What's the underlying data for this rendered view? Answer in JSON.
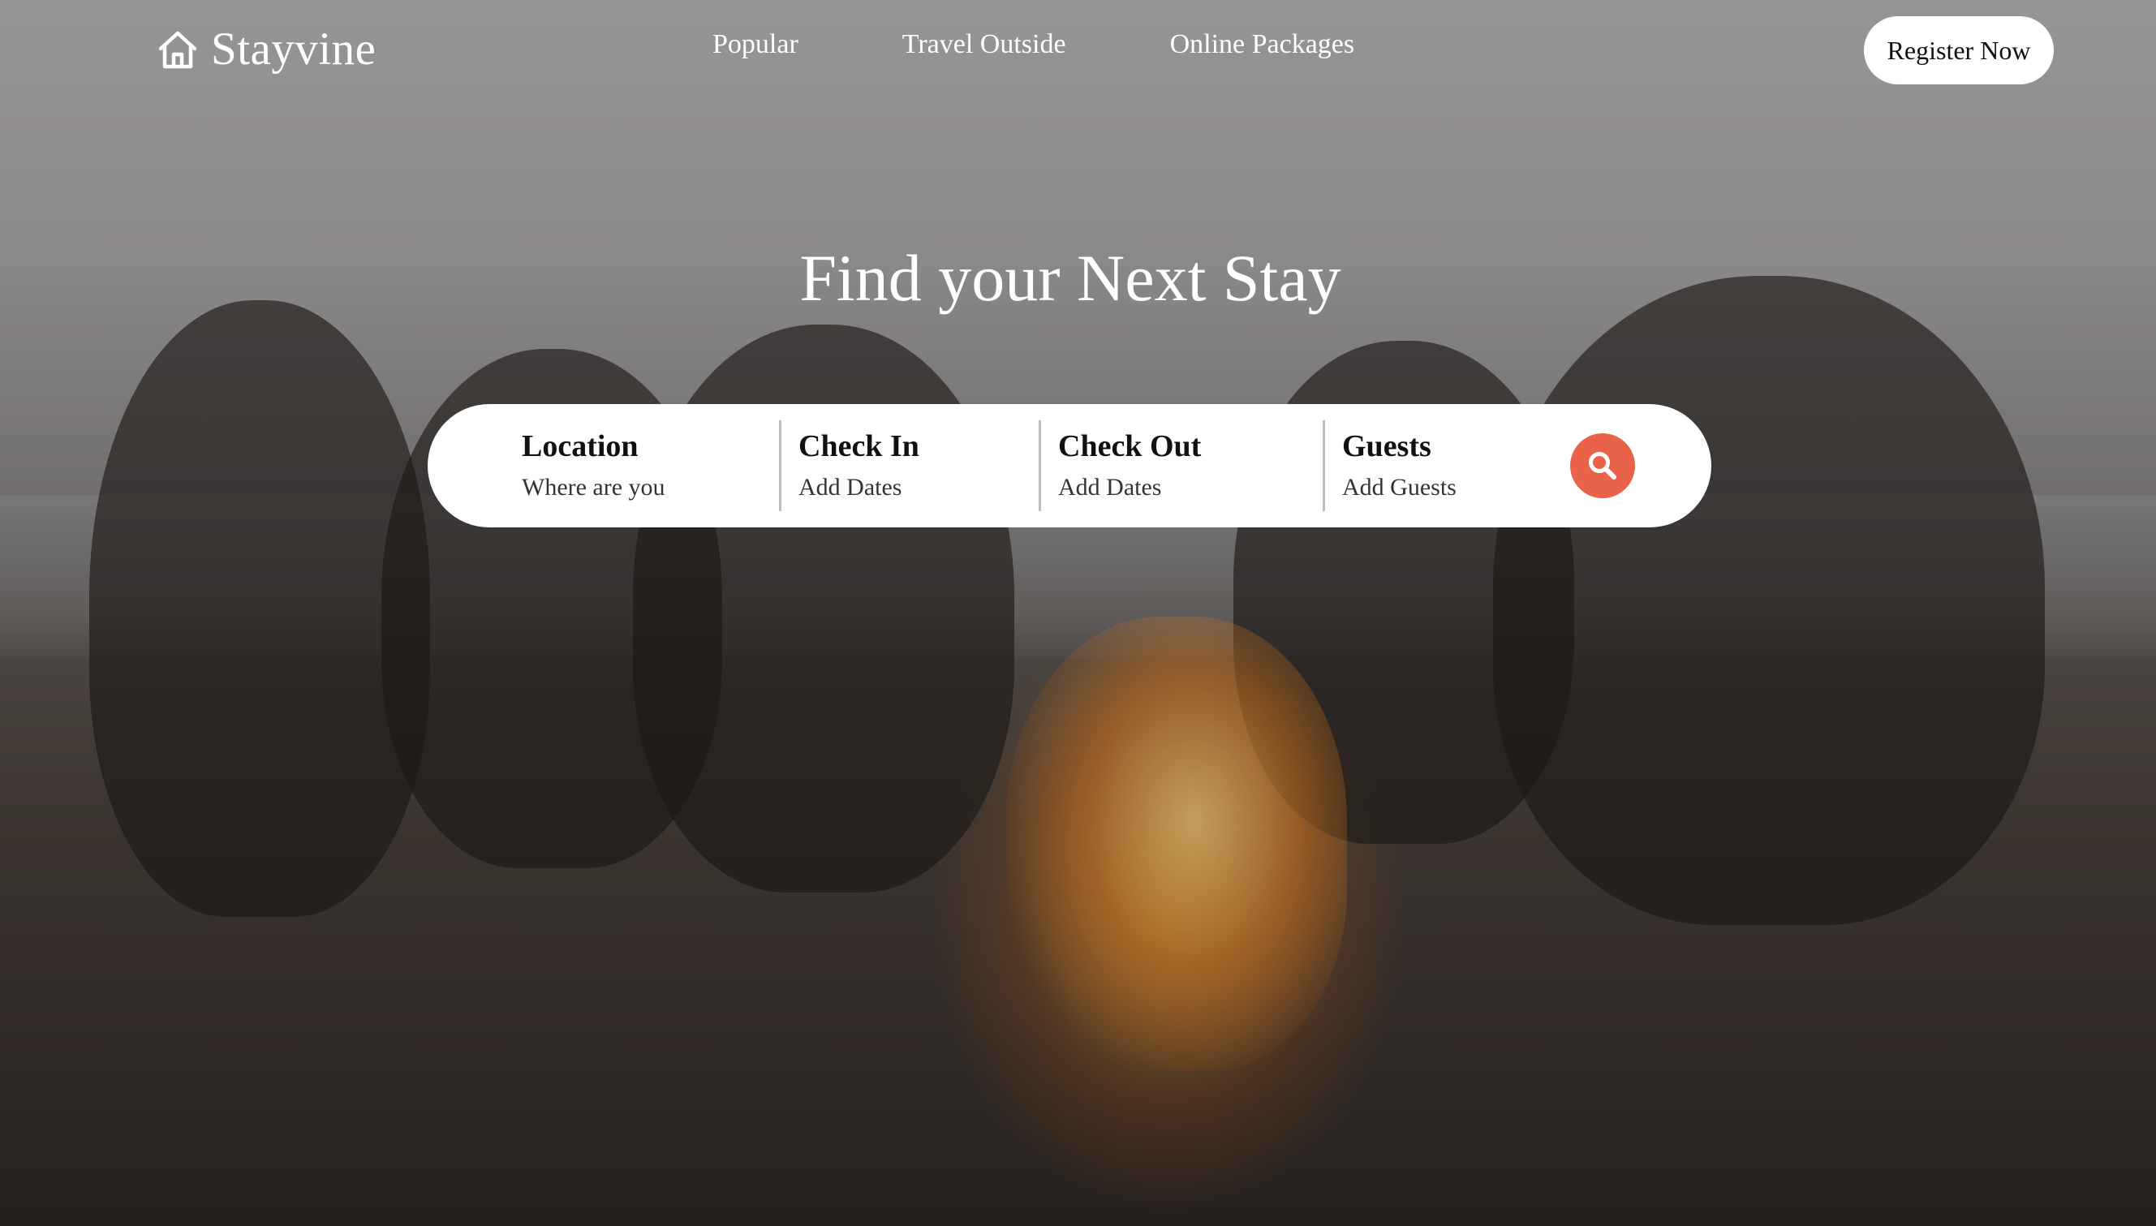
{
  "brand": {
    "name": "Stayvine",
    "icon": "home-icon"
  },
  "nav": {
    "links": [
      {
        "label": "Popular"
      },
      {
        "label": "Travel Outside"
      },
      {
        "label": "Online Packages"
      }
    ],
    "register_label": "Register Now"
  },
  "hero": {
    "title": "Find your Next Stay"
  },
  "search": {
    "fields": [
      {
        "label": "Location",
        "value": "Where are you"
      },
      {
        "label": "Check In",
        "value": "Add Dates"
      },
      {
        "label": "Check Out",
        "value": "Add Dates"
      },
      {
        "label": "Guests",
        "value": "Add Guests"
      }
    ],
    "button_icon": "search-icon",
    "accent_color": "#e8634a"
  }
}
